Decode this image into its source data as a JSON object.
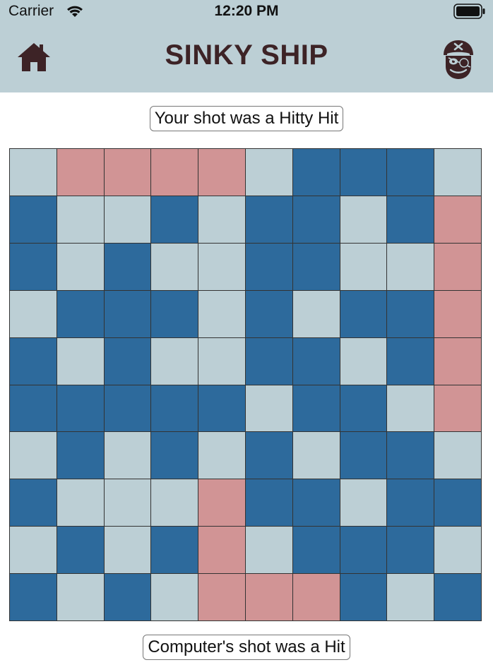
{
  "status_bar": {
    "carrier": "Carrier",
    "time": "12:20 PM"
  },
  "header": {
    "title": "SINKY SHIP",
    "home_icon": "home-icon",
    "profile_icon": "pirate-icon"
  },
  "messages": {
    "player_shot": "Your shot was a Hitty Hit",
    "computer_shot": "Computer's shot was a Hit"
  },
  "colors": {
    "header_bg": "#bccfd5",
    "water": "#bccfd5",
    "ship": "#2d6a9c",
    "hit": "#d19495",
    "title": "#3d2326"
  },
  "board": {
    "rows": [
      [
        "water",
        "hit",
        "hit",
        "hit",
        "hit",
        "water",
        "ship",
        "ship",
        "ship",
        "water"
      ],
      [
        "ship",
        "water",
        "water",
        "ship",
        "water",
        "ship",
        "ship",
        "water",
        "ship",
        "hit"
      ],
      [
        "ship",
        "water",
        "ship",
        "water",
        "water",
        "ship",
        "ship",
        "water",
        "water",
        "hit"
      ],
      [
        "water",
        "ship",
        "ship",
        "ship",
        "water",
        "ship",
        "water",
        "ship",
        "ship",
        "hit"
      ],
      [
        "ship",
        "water",
        "ship",
        "water",
        "water",
        "ship",
        "ship",
        "water",
        "ship",
        "hit"
      ],
      [
        "ship",
        "ship",
        "ship",
        "ship",
        "ship",
        "water",
        "ship",
        "ship",
        "water",
        "hit"
      ],
      [
        "water",
        "ship",
        "water",
        "ship",
        "water",
        "ship",
        "water",
        "ship",
        "ship",
        "water"
      ],
      [
        "ship",
        "water",
        "water",
        "water",
        "hit",
        "ship",
        "ship",
        "water",
        "ship",
        "ship"
      ],
      [
        "water",
        "ship",
        "water",
        "ship",
        "hit",
        "water",
        "ship",
        "ship",
        "ship",
        "water"
      ],
      [
        "ship",
        "water",
        "ship",
        "water",
        "hit",
        "hit",
        "hit",
        "ship",
        "water",
        "ship"
      ]
    ]
  }
}
